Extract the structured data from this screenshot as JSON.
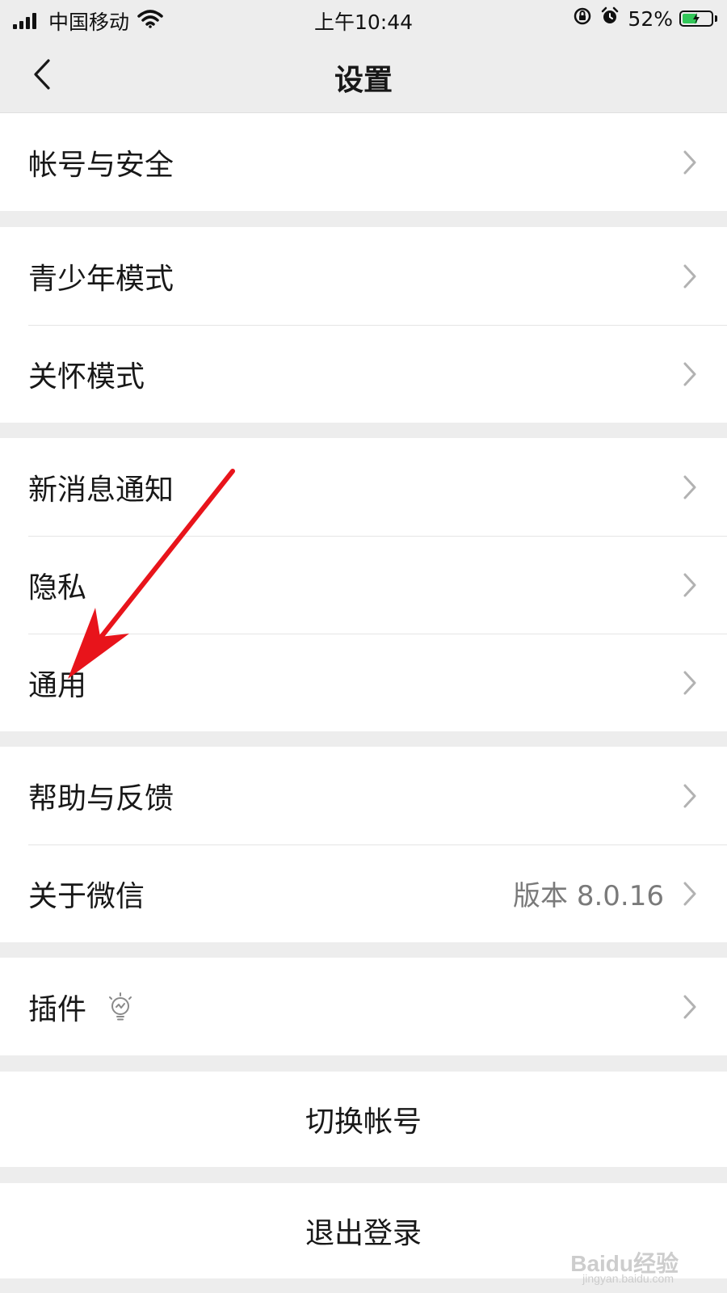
{
  "status_bar": {
    "carrier": "中国移动",
    "time": "上午10:44",
    "battery_percent": "52%",
    "battery_level": 0.52,
    "icons": [
      "signal-icon",
      "wifi-icon",
      "rotation-lock-icon",
      "alarm-icon",
      "battery-icon"
    ]
  },
  "nav": {
    "title": "设置",
    "back_icon": "chevron-left-icon"
  },
  "groups": [
    {
      "items": [
        {
          "label": "帐号与安全"
        }
      ]
    },
    {
      "items": [
        {
          "label": "青少年模式"
        },
        {
          "label": "关怀模式"
        }
      ]
    },
    {
      "items": [
        {
          "label": "新消息通知"
        },
        {
          "label": "隐私"
        },
        {
          "label": "通用"
        }
      ]
    },
    {
      "items": [
        {
          "label": "帮助与反馈"
        },
        {
          "label": "关于微信",
          "value": "版本 8.0.16"
        }
      ]
    },
    {
      "items": [
        {
          "label": "插件",
          "icon": "lightbulb-icon"
        }
      ]
    }
  ],
  "actions": {
    "switch_account": "切换帐号",
    "logout": "退出登录"
  },
  "watermark": {
    "text": "Baidu经验",
    "sub": "jingyan.baidu.com"
  },
  "colors": {
    "background": "#ededed",
    "row": "#ffffff",
    "text": "#181818",
    "secondary": "#7a7a7a",
    "chevron": "#b2b2b2",
    "annotation_arrow": "#e8141b",
    "battery": "#32c759"
  }
}
